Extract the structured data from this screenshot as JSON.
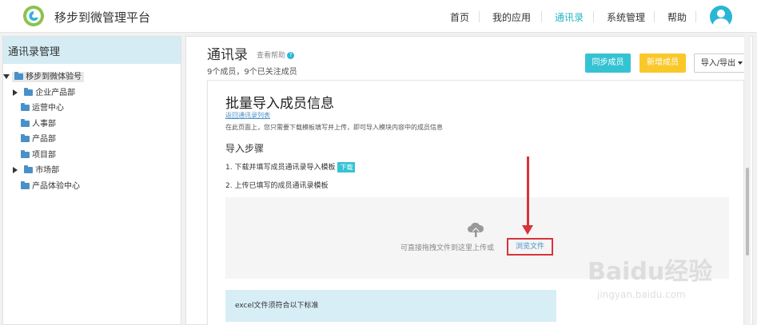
{
  "app": {
    "title": "移步到微管理平台"
  },
  "nav": {
    "items": [
      {
        "label": "首页"
      },
      {
        "label": "我的应用"
      },
      {
        "label": "通讯录",
        "active": true
      },
      {
        "label": "系统管理"
      },
      {
        "label": "帮助"
      }
    ],
    "accent_color": "#26b5c4"
  },
  "sidebar": {
    "title": "通讯录管理",
    "root": "移步到微体验号",
    "items": [
      {
        "label": "企业产品部",
        "expandable": true
      },
      {
        "label": "运营中心",
        "expandable": false
      },
      {
        "label": "人事部",
        "expandable": false
      },
      {
        "label": "产品部",
        "expandable": false
      },
      {
        "label": "项目部",
        "expandable": false
      },
      {
        "label": "市场部",
        "expandable": true
      },
      {
        "label": "产品体验中心",
        "expandable": false
      }
    ]
  },
  "header": {
    "title": "通讯录",
    "help": "查看帮助",
    "member_count": "9个成员，9个已关注成员",
    "sync_button": "同步成员",
    "add_button": "新增成员",
    "import_export_button": "导入/导出",
    "sync_color": "#35c3d3",
    "add_color": "#f9c82a"
  },
  "import": {
    "title": "批量导入成员信息",
    "back_link": "返回通讯录列表",
    "description": "在此页面上，您只需要下载模板填写并上传，即可导入模块内容中的成员信息",
    "steps_title": "导入步骤",
    "step1": "1. 下载并填写成员通讯录导入模板",
    "download_button": "下载",
    "step2": "2. 上传已填写的成员通讯录模板",
    "drop_text": "可直接拖拽文件到这里上传或",
    "browse_button": "浏览文件",
    "excel_notice": "excel文件须符合以下标准"
  },
  "watermark": {
    "text": "Baidu经验",
    "sub": "jingyan.baidu.com"
  }
}
